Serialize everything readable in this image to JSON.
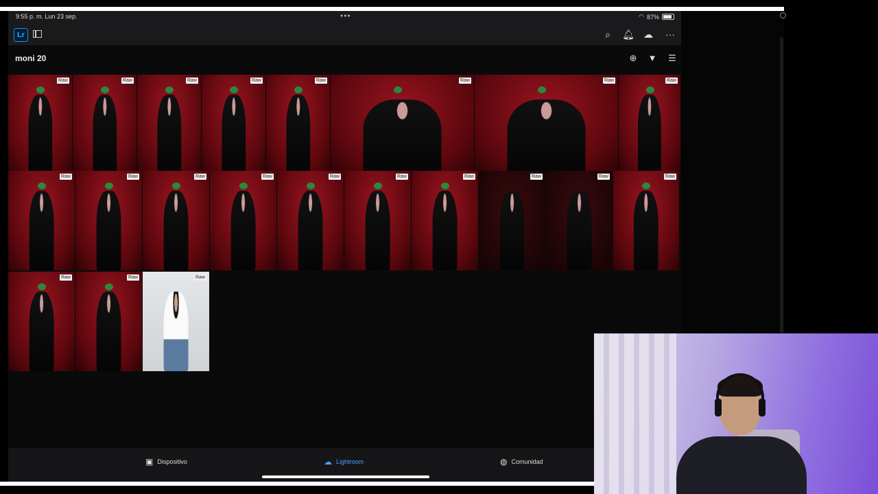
{
  "status": {
    "time": "9:55 p. m.   Lun 23 sep.",
    "battery": "87%"
  },
  "app": {
    "logo": "Lr"
  },
  "album": {
    "title": "moni 20"
  },
  "badge": "Raw",
  "tabs": [
    {
      "label": "Dispositivo",
      "icon": "device-icon",
      "active": false
    },
    {
      "label": "Lightroom",
      "icon": "lightroom-cloud-icon",
      "active": true
    },
    {
      "label": "Comunidad",
      "icon": "globe-icon",
      "active": false
    }
  ],
  "colors": {
    "accent": "#4aa0ff",
    "background": "#0a0a0b",
    "photo_red": "#7a0a12"
  }
}
